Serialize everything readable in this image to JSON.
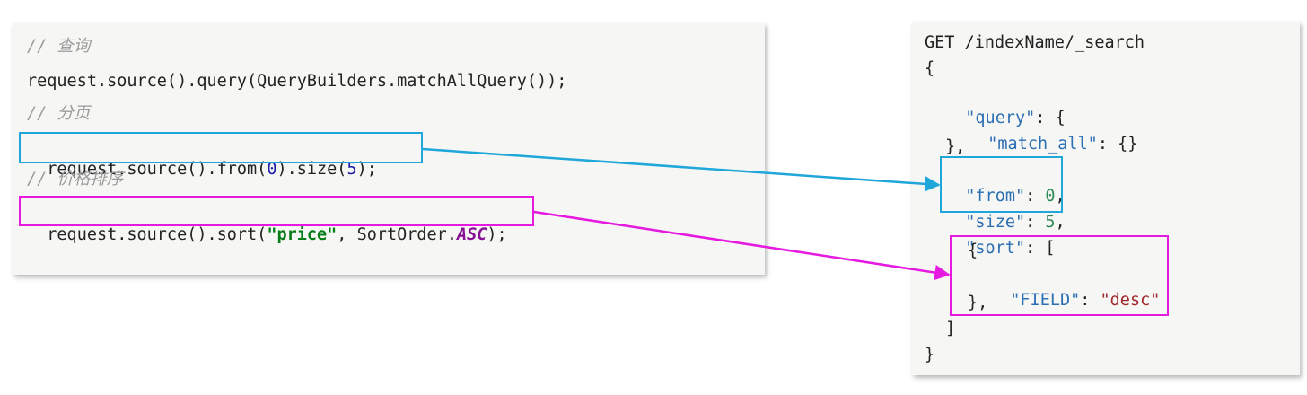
{
  "java": {
    "comment_query": "// 查询",
    "line_query": "request.source().query(QueryBuilders.matchAllQuery());",
    "comment_paging": "// 分页",
    "line_from_a": "request.source().from(",
    "line_from_num": "0",
    "line_from_b": ").size(",
    "line_size_num": "5",
    "line_from_c": ");",
    "comment_sort": "// 价格排序",
    "line_sort_a": "request.source().sort(",
    "line_sort_str": "\"price\"",
    "line_sort_b": ", SortOrder.",
    "line_sort_enum": "ASC",
    "line_sort_c": ");"
  },
  "dsl": {
    "request_line": "GET /indexName/_search",
    "open_brace": "{",
    "query_key": "\"query\"",
    "query_rest": ": {",
    "match_all_key": "\"match_all\"",
    "match_all_rest": ": {}",
    "query_close": "},",
    "from_key": "\"from\"",
    "from_colon": ": ",
    "from_value": "0",
    "from_comma": ",",
    "size_key": "\"size\"",
    "size_colon": ": ",
    "size_value": "5",
    "size_comma": ",",
    "sort_key": "\"sort\"",
    "sort_rest": ": [",
    "sort_obj_open": "{",
    "field_key": "\"FIELD\"",
    "field_colon": ": ",
    "field_value": "\"desc\"",
    "sort_obj_close": "},",
    "sort_close": "]",
    "close_brace": "}"
  },
  "colors": {
    "paging_highlight": "#1ea7d8",
    "sort_highlight": "#e619e0"
  }
}
